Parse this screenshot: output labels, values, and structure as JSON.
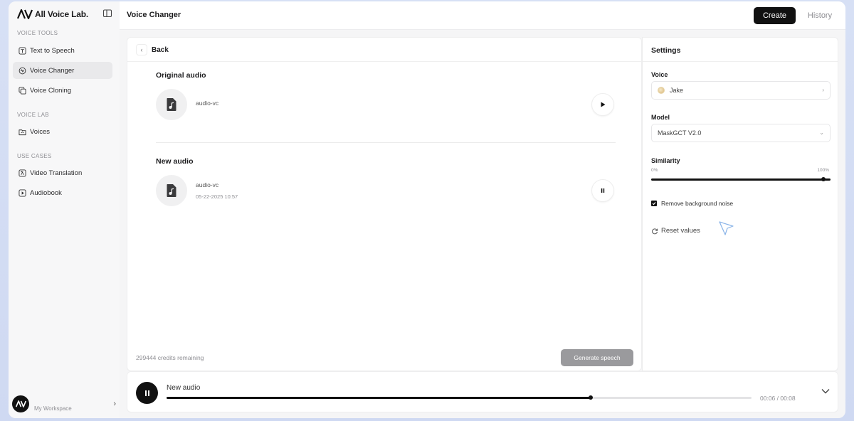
{
  "app": {
    "brand": "All Voice Lab.",
    "page_title": "Voice Changer"
  },
  "header": {
    "create_label": "Create",
    "history_label": "History"
  },
  "sidebar": {
    "sections": [
      {
        "label": "VOICE TOOLS"
      },
      {
        "label": "VOICE LAB"
      },
      {
        "label": "USE CASES"
      }
    ],
    "items": [
      {
        "label": "Text to Speech",
        "icon": "text-to-speech-icon"
      },
      {
        "label": "Voice Changer",
        "icon": "voice-changer-icon",
        "active": true
      },
      {
        "label": "Voice Cloning",
        "icon": "voice-cloning-icon"
      },
      {
        "label": "Voices",
        "icon": "voices-folder-icon"
      },
      {
        "label": "Video Translation",
        "icon": "video-translation-icon"
      },
      {
        "label": "Audiobook",
        "icon": "audiobook-icon"
      }
    ],
    "workspace_label": "My Workspace"
  },
  "main": {
    "back_label": "Back",
    "original": {
      "title": "Original audio",
      "file_name": "audio-vc"
    },
    "new": {
      "title": "New audio",
      "file_name": "audio-vc",
      "date": "05-22-2025 10:57"
    },
    "credits": "299444 credits remaining",
    "generate_label": "Generate speech"
  },
  "settings": {
    "title": "Settings",
    "voice_label": "Voice",
    "voice_value": "Jake",
    "model_label": "Model",
    "model_value": "MaskGCT V2.0",
    "similarity_label": "Similarity",
    "similarity_min": "0%",
    "similarity_max": "100%",
    "similarity_value": 0.96,
    "remove_noise_label": "Remove background noise",
    "remove_noise_checked": true,
    "reset_label": "Reset values"
  },
  "player": {
    "title": "New audio",
    "time": "00:06 / 00:08",
    "progress": 0.725
  }
}
